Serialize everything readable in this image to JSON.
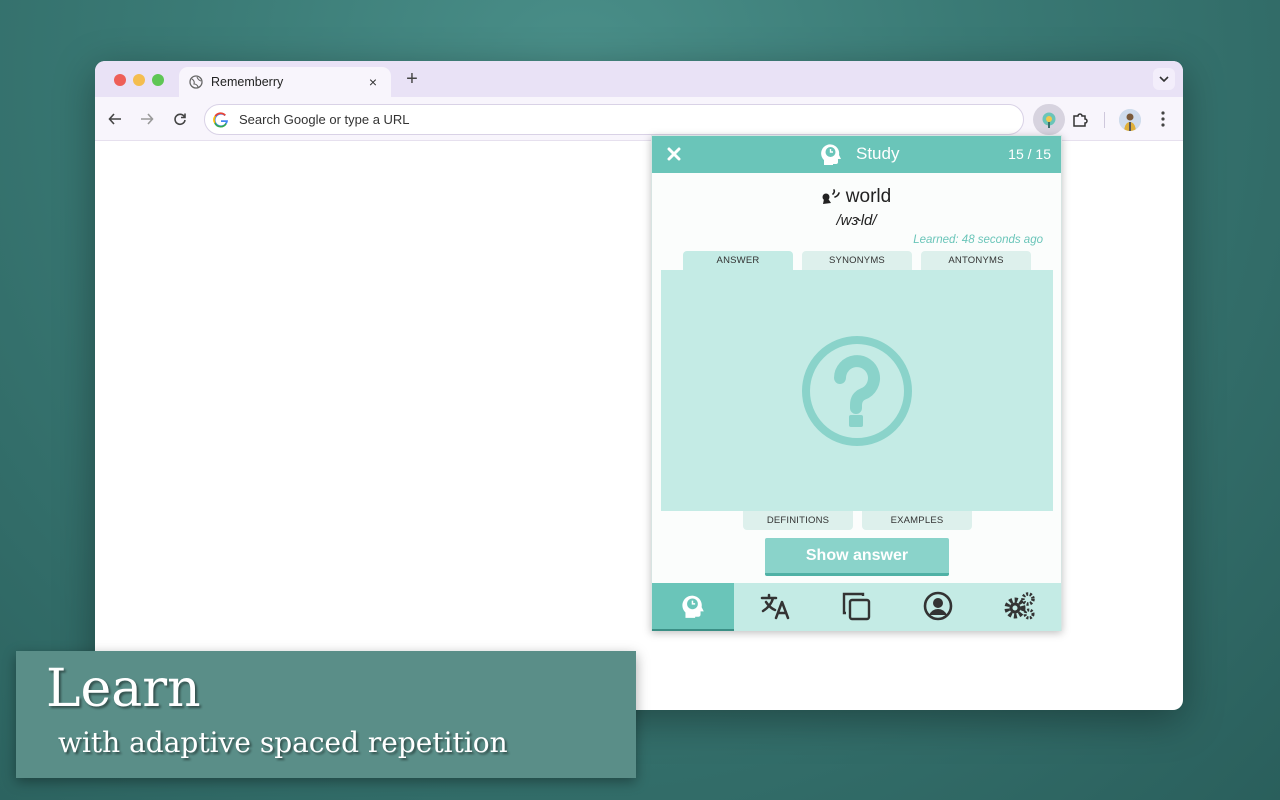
{
  "browser": {
    "tab_title": "Rememberry",
    "tab_close": "×",
    "new_tab": "+",
    "omnibox_placeholder": "Search Google or type a URL"
  },
  "popup": {
    "title": "Study",
    "counter": "15 / 15",
    "word": "world",
    "phonetic": "/wɝld/",
    "learned": "Learned: 48 seconds ago",
    "tabs_top": [
      "ANSWER",
      "SYNONYMS",
      "ANTONYMS"
    ],
    "tabs_bottom": [
      "DEFINITIONS",
      "EXAMPLES"
    ],
    "active_tab": "ANSWER",
    "show_answer": "Show answer",
    "nav": [
      "study-icon",
      "translate-icon",
      "cards-icon",
      "profile-icon",
      "settings-icon"
    ],
    "accent": "#6ac5b9",
    "panel_color": "#c4ebe5"
  },
  "caption": {
    "title": "Learn",
    "subtitle": "with adaptive spaced repetition"
  }
}
